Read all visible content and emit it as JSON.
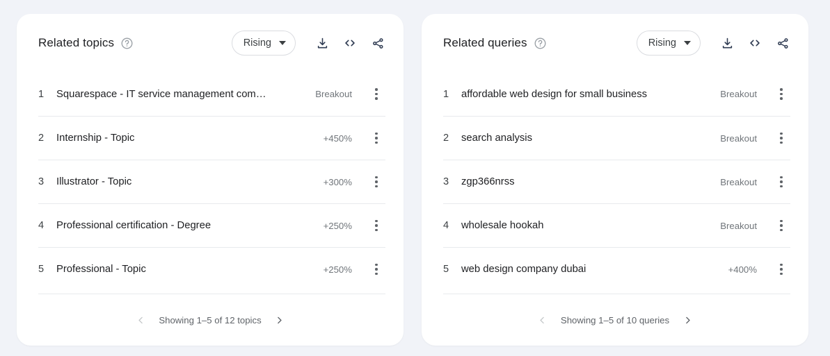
{
  "page": {
    "background_color": "#f1f3f8",
    "card_background": "#ffffff"
  },
  "cards": [
    {
      "title": "Related topics",
      "help_icon": "help-circle-icon",
      "sort": {
        "label": "Rising",
        "caret_icon": "chevron-down-icon"
      },
      "actions": [
        {
          "icon": "download-icon"
        },
        {
          "icon": "embed-code-icon"
        },
        {
          "icon": "share-icon"
        }
      ],
      "rows": [
        {
          "rank": "1",
          "title": "Squarespace - IT service management com…",
          "value": "Breakout",
          "menu_icon": "more-vert-icon"
        },
        {
          "rank": "2",
          "title": "Internship - Topic",
          "value": "+450%",
          "menu_icon": "more-vert-icon"
        },
        {
          "rank": "3",
          "title": "Illustrator - Topic",
          "value": "+300%",
          "menu_icon": "more-vert-icon"
        },
        {
          "rank": "4",
          "title": "Professional certification - Degree",
          "value": "+250%",
          "menu_icon": "more-vert-icon"
        },
        {
          "rank": "5",
          "title": "Professional - Topic",
          "value": "+250%",
          "menu_icon": "more-vert-icon"
        }
      ],
      "footer": {
        "prev_icon": "chevron-left-icon",
        "prev_enabled": false,
        "text": "Showing 1–5 of 12 topics",
        "next_icon": "chevron-right-icon",
        "next_enabled": true
      }
    },
    {
      "title": "Related queries",
      "help_icon": "help-circle-icon",
      "sort": {
        "label": "Rising",
        "caret_icon": "chevron-down-icon"
      },
      "actions": [
        {
          "icon": "download-icon"
        },
        {
          "icon": "embed-code-icon"
        },
        {
          "icon": "share-icon"
        }
      ],
      "rows": [
        {
          "rank": "1",
          "title": "affordable web design for small business",
          "value": "Breakout",
          "menu_icon": "more-vert-icon"
        },
        {
          "rank": "2",
          "title": "search analysis",
          "value": "Breakout",
          "menu_icon": "more-vert-icon"
        },
        {
          "rank": "3",
          "title": "zgp366nrss",
          "value": "Breakout",
          "menu_icon": "more-vert-icon"
        },
        {
          "rank": "4",
          "title": "wholesale hookah",
          "value": "Breakout",
          "menu_icon": "more-vert-icon"
        },
        {
          "rank": "5",
          "title": "web design company dubai",
          "value": "+400%",
          "menu_icon": "more-vert-icon"
        }
      ],
      "footer": {
        "prev_icon": "chevron-left-icon",
        "prev_enabled": false,
        "text": "Showing 1–5 of 10 queries",
        "next_icon": "chevron-right-icon",
        "next_enabled": true
      }
    }
  ]
}
